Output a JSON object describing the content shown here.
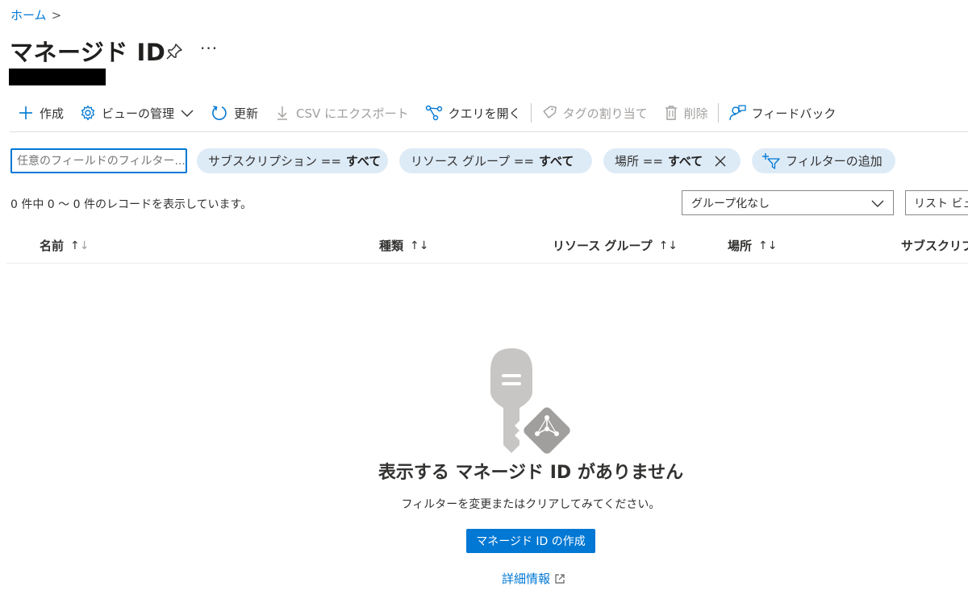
{
  "breadcrumb": {
    "home": "ホーム",
    "separator": ">"
  },
  "page": {
    "title": "マネージド ID",
    "more": "···"
  },
  "toolbar": {
    "create": "作成",
    "manage_view": "ビューの管理",
    "refresh": "更新",
    "export_csv": "CSV にエクスポート",
    "open_query": "クエリを開く",
    "assign_tags": "タグの割り当て",
    "delete": "削除",
    "feedback": "フィードバック"
  },
  "filters": {
    "search_placeholder": "任意のフィールドのフィルター...",
    "subscription": {
      "label": "サブスクリプション ==",
      "value": "すべて"
    },
    "resource_group": {
      "label": "リソース グループ ==",
      "value": "すべて"
    },
    "location": {
      "label": "場所 ==",
      "value": "すべて"
    },
    "add_filter": "フィルターの追加"
  },
  "summary": "0 件中 0 〜 0 件のレコードを表示しています。",
  "grouping": {
    "selected": "グループ化なし"
  },
  "view_select": {
    "selected": "リスト ビュー"
  },
  "table": {
    "columns": [
      "名前",
      "種類",
      "リソース グループ",
      "場所",
      "サブスクリプション"
    ]
  },
  "empty": {
    "title": "表示する マネージド ID がありません",
    "subtitle": "フィルターを変更またはクリアしてみてください。",
    "create_button": "マネージド ID の作成",
    "learn_more": "詳細情報"
  },
  "colors": {
    "accent": "#0078d4",
    "pill": "#ddebf7",
    "disabled": "#a19f9d"
  }
}
